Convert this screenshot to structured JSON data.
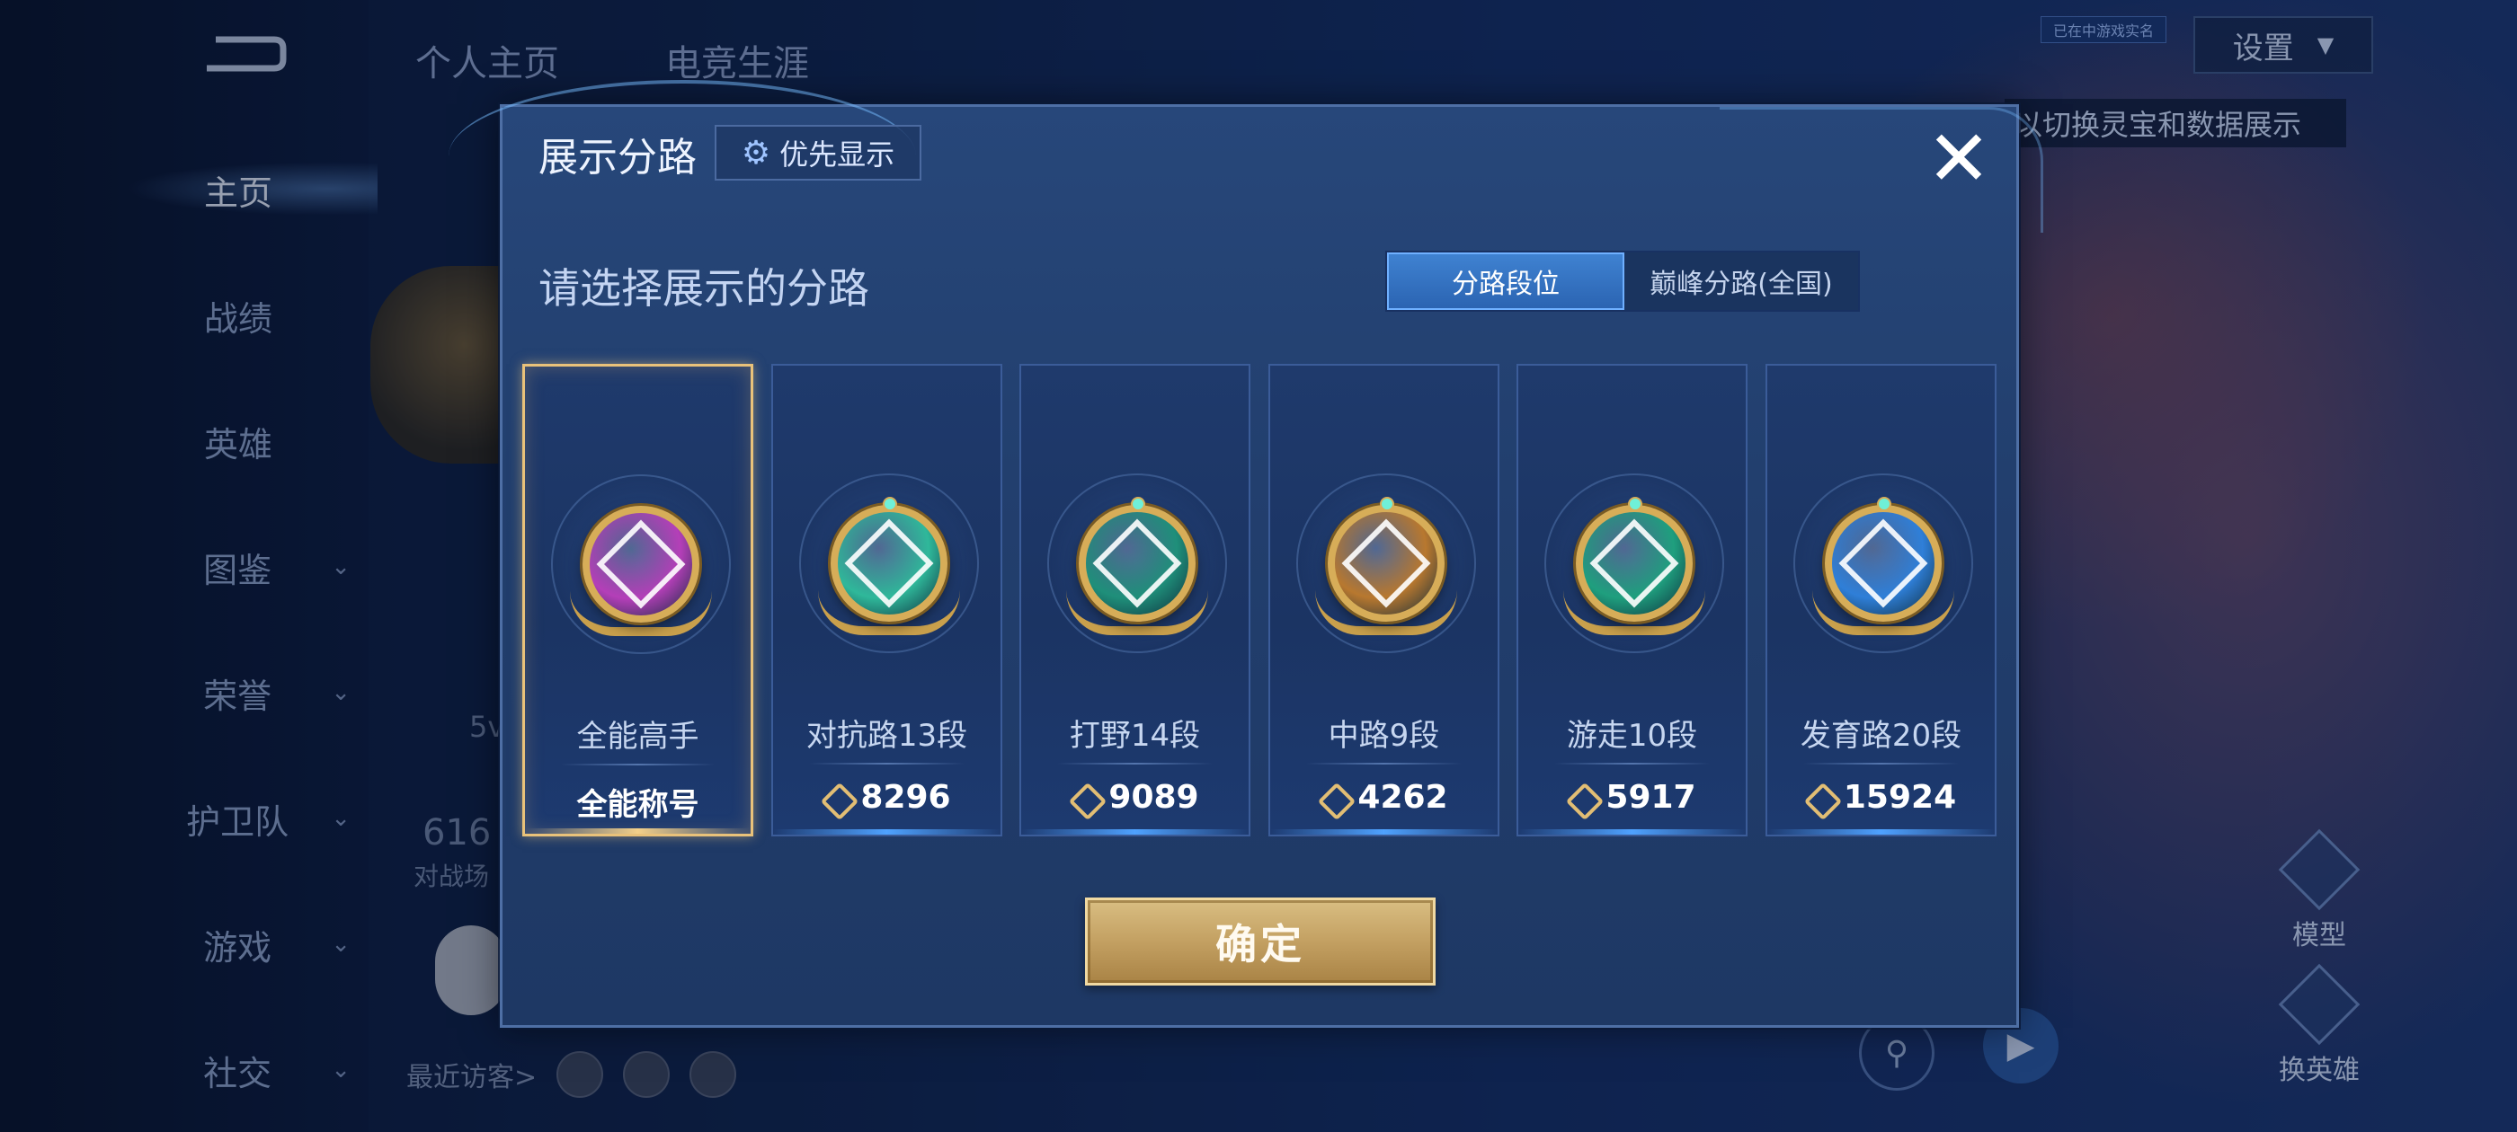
{
  "background": {
    "sidebar": {
      "items": [
        {
          "label": "主页",
          "active": true,
          "has_chevron": false
        },
        {
          "label": "战绩",
          "active": false,
          "has_chevron": false
        },
        {
          "label": "英雄",
          "active": false,
          "has_chevron": false
        },
        {
          "label": "图鉴",
          "active": false,
          "has_chevron": true
        },
        {
          "label": "荣誉",
          "active": false,
          "has_chevron": true
        },
        {
          "label": "护卫队",
          "active": false,
          "has_chevron": true
        },
        {
          "label": "游戏",
          "active": false,
          "has_chevron": true
        },
        {
          "label": "社交",
          "active": false,
          "has_chevron": true
        }
      ]
    },
    "top_tabs": [
      "个人主页",
      "电竞生涯"
    ],
    "settings_label": "设置",
    "verify_badge": "已在中游戏实名",
    "hint_text": "以切换灵宝和数据展示",
    "partial_text_1": "5v",
    "partial_text_2": "616",
    "partial_text_3": "对战场",
    "visitors_label": "最近访客>",
    "right_buttons": [
      "模型",
      "换英雄"
    ]
  },
  "modal": {
    "title": "展示分路",
    "priority_button": "优先显示",
    "close_icon": "close-icon",
    "subtitle": "请选择展示的分路",
    "segment": {
      "options": [
        "分路段位",
        "巅峰分路(全国)"
      ],
      "selected_index": 0
    },
    "cards": [
      {
        "name": "全能高手",
        "value": "全能称号",
        "is_title": true,
        "selected": true,
        "badge_color": "#b43fb8"
      },
      {
        "name": "对抗路13段",
        "value": "8296",
        "is_title": false,
        "selected": false,
        "badge_color": "#2fb89a"
      },
      {
        "name": "打野14段",
        "value": "9089",
        "is_title": false,
        "selected": false,
        "badge_color": "#1f8f7a"
      },
      {
        "name": "中路9段",
        "value": "4262",
        "is_title": false,
        "selected": false,
        "badge_color": "#b8782f"
      },
      {
        "name": "游走10段",
        "value": "5917",
        "is_title": false,
        "selected": false,
        "badge_color": "#1f9f7e"
      },
      {
        "name": "发育路20段",
        "value": "15924",
        "is_title": false,
        "selected": false,
        "badge_color": "#2f7fd8"
      }
    ],
    "confirm_button": "确定"
  },
  "colors": {
    "accent_blue": "#3f82d1",
    "gold": "#d7ad58",
    "selected_border": "#e9c27a"
  }
}
